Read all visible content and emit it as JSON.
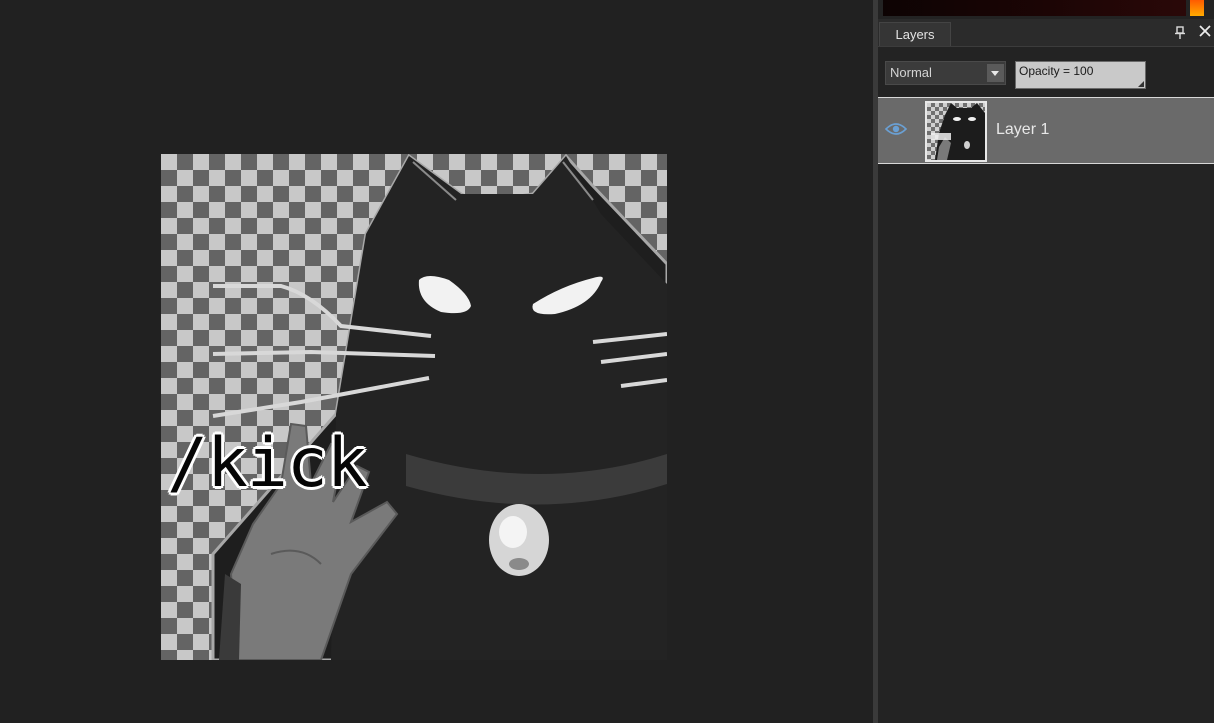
{
  "canvas": {
    "image_text": "/kick"
  },
  "layers_panel": {
    "tab_label": "Layers",
    "blend_mode": "Normal",
    "opacity_label": "Opacity = 100",
    "layers": [
      {
        "name": "Layer 1",
        "visible": true,
        "selected": true
      }
    ]
  },
  "colors": {
    "workspace_bg": "#212121",
    "panel_bg": "#232323",
    "selected_row": "#6a6a6a",
    "eye_icon": "#6aa0d4"
  },
  "icons": {
    "pin": "pin-icon",
    "close": "close-icon",
    "visibility": "eye-icon",
    "dropdown": "chevron-down-icon"
  }
}
